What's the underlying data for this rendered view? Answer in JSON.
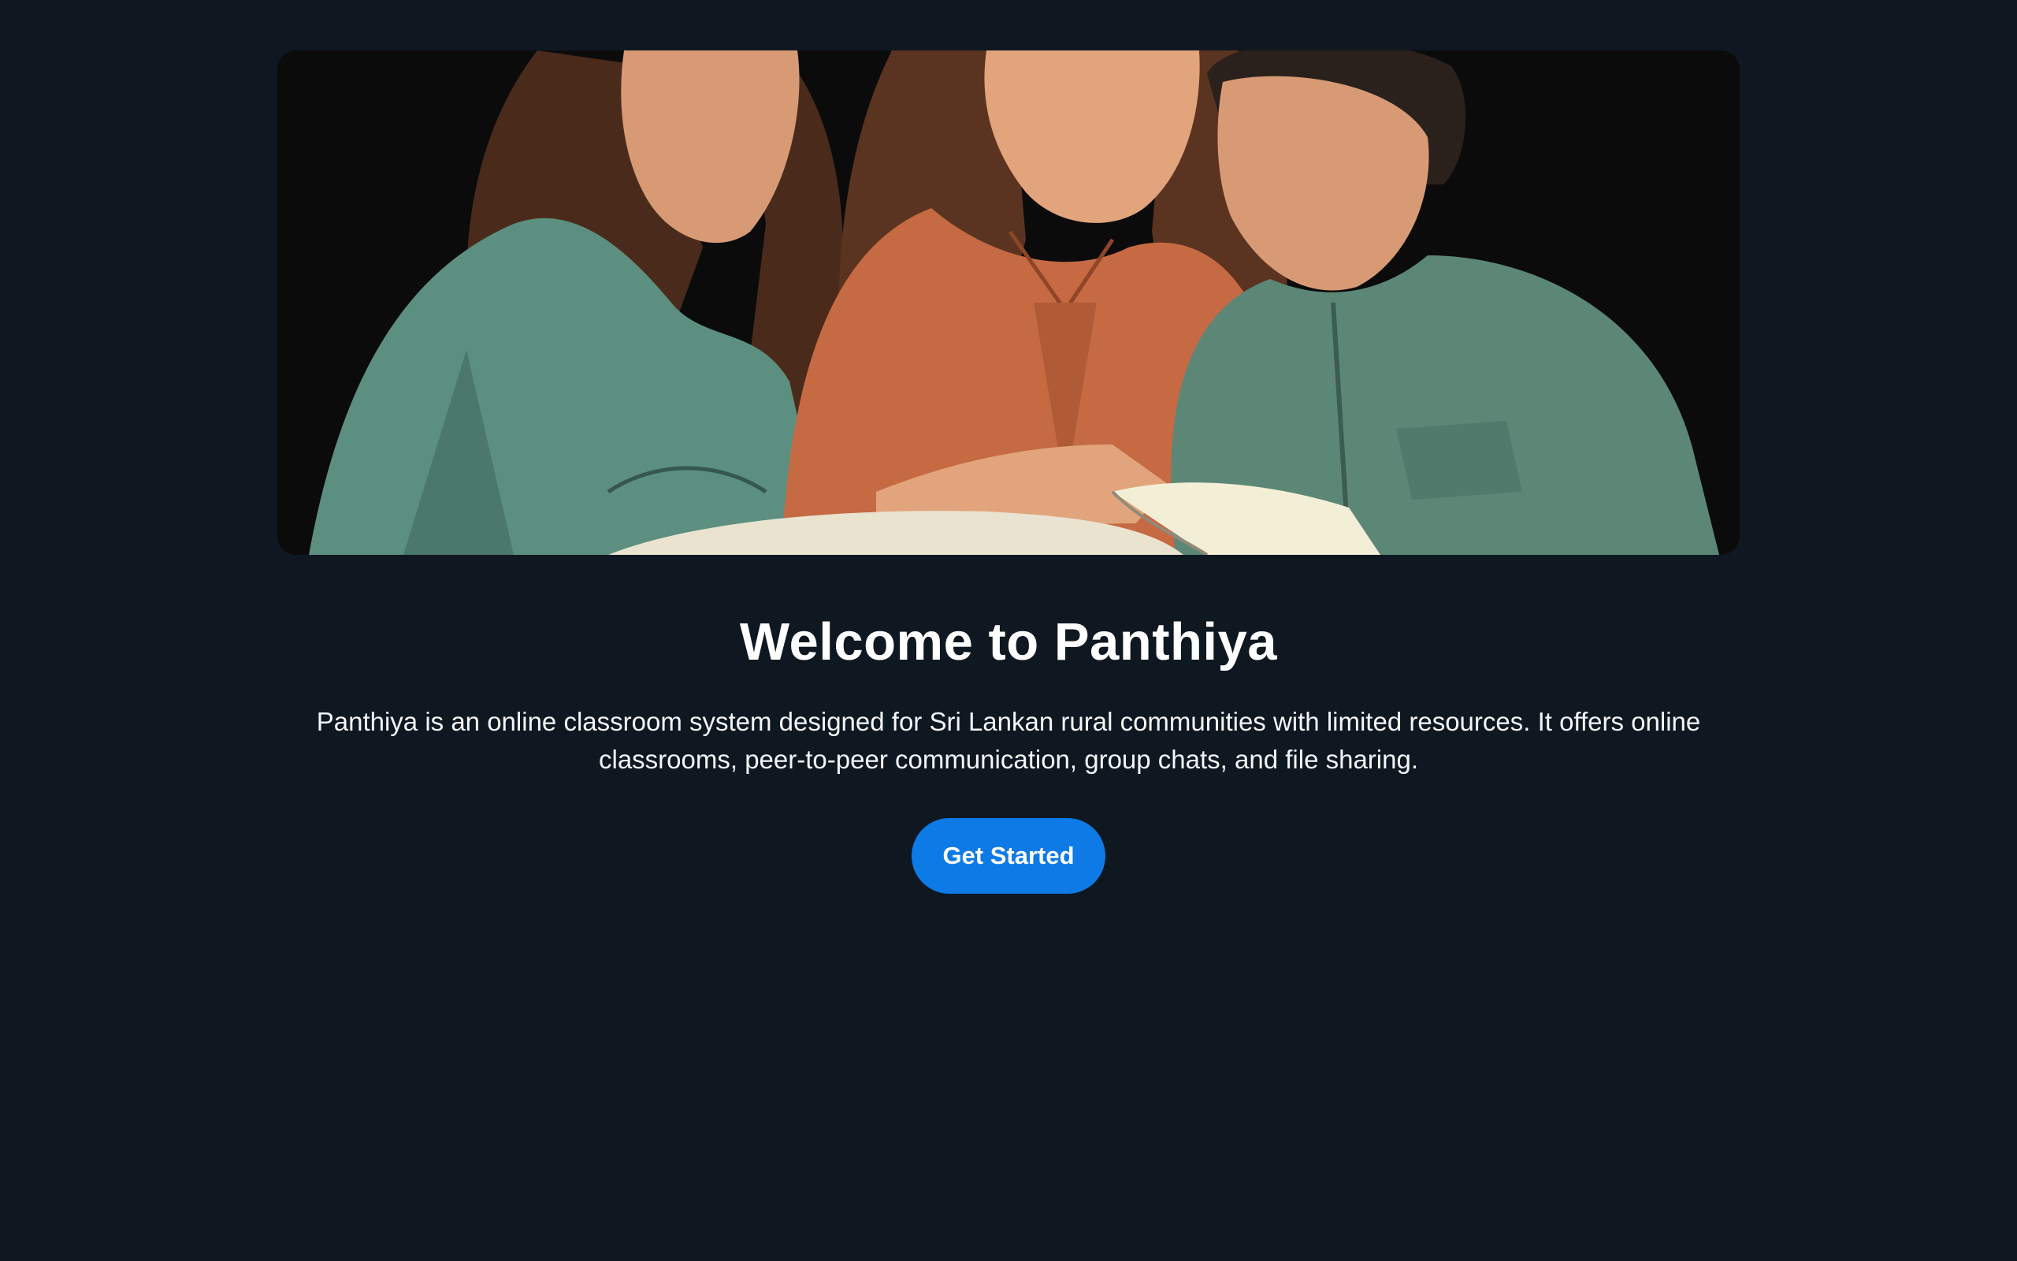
{
  "hero": {
    "image_name": "students-studying-illustration"
  },
  "main": {
    "title": "Welcome to Panthiya",
    "description": "Panthiya is an online classroom system designed for Sri Lankan rural communities with limited resources. It offers online classrooms, peer-to-peer communication, group chats, and file sharing.",
    "cta_label": "Get Started"
  },
  "colors": {
    "background": "#0f1821",
    "accent": "#0d7ae6",
    "text": "#ffffff"
  }
}
